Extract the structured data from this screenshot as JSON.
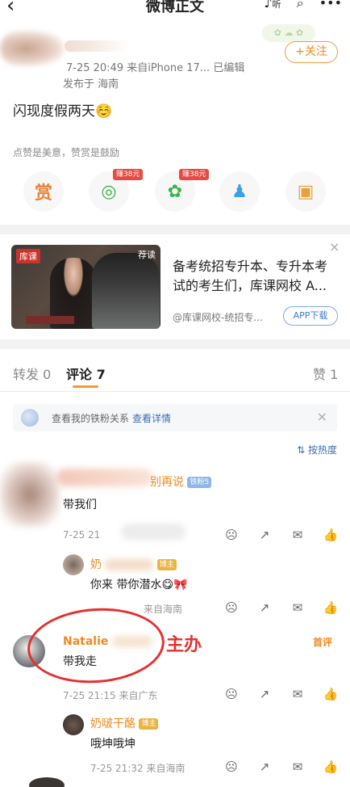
{
  "header": {
    "back_icon": "chevron-left-icon",
    "title": "微博正文",
    "listen_label": "听",
    "icons": [
      "listen-icon",
      "search-icon",
      "more-icon"
    ]
  },
  "post": {
    "time_source": "7-25 20:49  来自iPhone 17...  已编辑",
    "location": "发布于 海南",
    "follow_label": "+关注",
    "text": "闪现度假两天☺️",
    "tip": "点赞是美意，赞赏是鼓励",
    "actions": [
      {
        "name": "reward",
        "label": "赏",
        "color": "#e8843a"
      },
      {
        "name": "wechat",
        "glyph": "◎",
        "badge": "赚38元",
        "color": "#39b54a"
      },
      {
        "name": "moments",
        "glyph": "✿",
        "badge": "赚38元",
        "color": "#39b54a"
      },
      {
        "name": "qq",
        "glyph": "♟",
        "color": "#3aa0e8"
      },
      {
        "name": "save-image",
        "glyph": "▣",
        "color": "#e8a23a"
      }
    ]
  },
  "ad": {
    "logo": "库课",
    "tag": "荐读",
    "title": "备考统招专升本、专升本考试的考生们，库课网校 A...",
    "source": "@库课网校-统招专...",
    "button": "APP下载",
    "close": "×"
  },
  "tabs": {
    "repost": "转发 0",
    "comment": "评论 7",
    "like": "赞 1"
  },
  "fans_bar": {
    "text": "查看我的铁粉关系",
    "link": "查看详情",
    "close": "×"
  },
  "sort_label": "按热度",
  "comments": [
    {
      "name_suffix": "别再说",
      "tag": "铁粉5",
      "text": "带我们",
      "time": "7-25 21"
    },
    {
      "name": "奶",
      "tag": "博主",
      "text": "你来 带你潜水😋🎀",
      "time": "来自海南"
    },
    {
      "name": "Natalie",
      "text": "带我走",
      "time": "7-25 21:15  来自广东",
      "badge": "首评"
    },
    {
      "name": "奶啵干酪",
      "tag": "博主",
      "text": "哦坤哦坤",
      "time": "7-25 21:32  来自海南"
    }
  ],
  "annotation": "主办",
  "colors": {
    "accent": "#f08a20",
    "link": "#3a6fb0",
    "annotation": "#e53030"
  }
}
